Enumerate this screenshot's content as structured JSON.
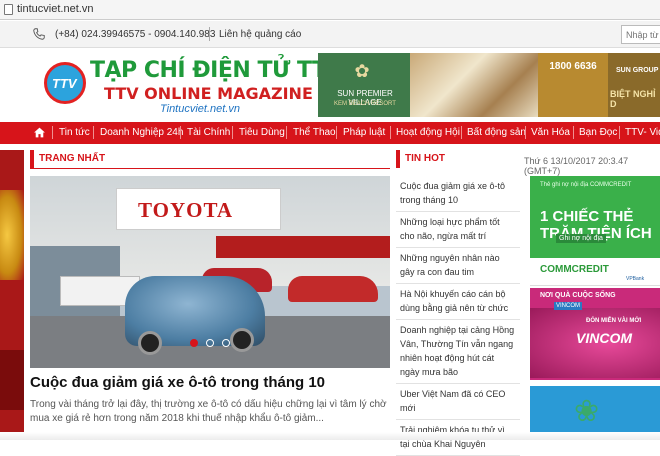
{
  "browser": {
    "url": "tintucviet.net.vn"
  },
  "topbar": {
    "phone": "(+84) 024.39946575 - 0904.140.983",
    "ads_link": "Liên hệ quảng cáo",
    "search_placeholder": "Nhập từ"
  },
  "logo": {
    "badge": "TTV",
    "title": "TẠP CHÍ ĐIỆN TỬ TTV",
    "subtitle": "TTV ONLINE MAGAZINE",
    "site": "Tintucviet.net.vn"
  },
  "banner": {
    "resort_name": "SUN PREMIER VILLAGE",
    "resort_sub": "KEM BEACH RESORT",
    "hotline": "1800 6636",
    "group": "SUN GROUP",
    "right_text": "BIỆT NGHỈ D"
  },
  "nav": {
    "items": [
      "Tin tức",
      "Doanh Nghiệp 24h",
      "Tài Chính",
      "Tiêu Dùng",
      "Thể Thao",
      "Pháp luật",
      "Hoạt động Hội",
      "Bất động sản",
      "Văn Hóa",
      "Bạn Đọc",
      "TTV- Vid"
    ]
  },
  "main": {
    "section": "TRANG NHẤT",
    "hero": {
      "brand": "TOYOTA",
      "title": "Cuộc đua giảm giá xe ô-tô trong tháng 10",
      "summary": "Trong vài tháng trở lại đây, thị trường xe ô-tô có dấu hiệu chững lại vì tâm lý chờ mua xe giá rẻ hơn trong năm 2018 khi thuế nhập khẩu ô-tô giảm..."
    }
  },
  "hot": {
    "label": "TIN HOT",
    "datetime": "Thứ 6 13/10/2017 20:3.47 (GMT+7)",
    "items": [
      "Cuộc đua giảm giá xe ô-tô trong tháng 10",
      "Những loại hực phẩm tốt cho não, ngừa mất trí",
      "Những nguyên nhân nào gây ra con đau tim",
      "Hà Nội khuyến cáo cán bộ dùng bằng giả nên từ chức",
      "Doanh nghiệp tại cảng Hồng Vân, Thường Tín vẫn ngang nhiên hoạt động hút cát ngày mưa bão",
      "Uber Việt Nam đã có CEO mới",
      "Trải nghiệm khóa tu thử vì tại chùa Khai Nguyên"
    ]
  },
  "ads": {
    "commcredit_top": "Thẻ ghi nợ nội địa COMMCREDIT",
    "commcredit_card": "1 CHIẾC THẺ TRĂM TIỆN ÍCH",
    "commcredit_tag": "Ghi nợ nội địa",
    "commcredit_logo": "COMMCREDIT",
    "commcredit_bank": "VPBank",
    "vincom_top": "NƠI QUÀ CUỘC SỐNG",
    "vincom_invite": "ĐÓN MIỄN VÀI MỚI",
    "vincom_name": "VINCOM",
    "vincom_brand": "VINCOM"
  },
  "colors": {
    "nav_bg": "#d7141a",
    "accent": "#d7141a",
    "logo_green": "#1f9a3a"
  }
}
